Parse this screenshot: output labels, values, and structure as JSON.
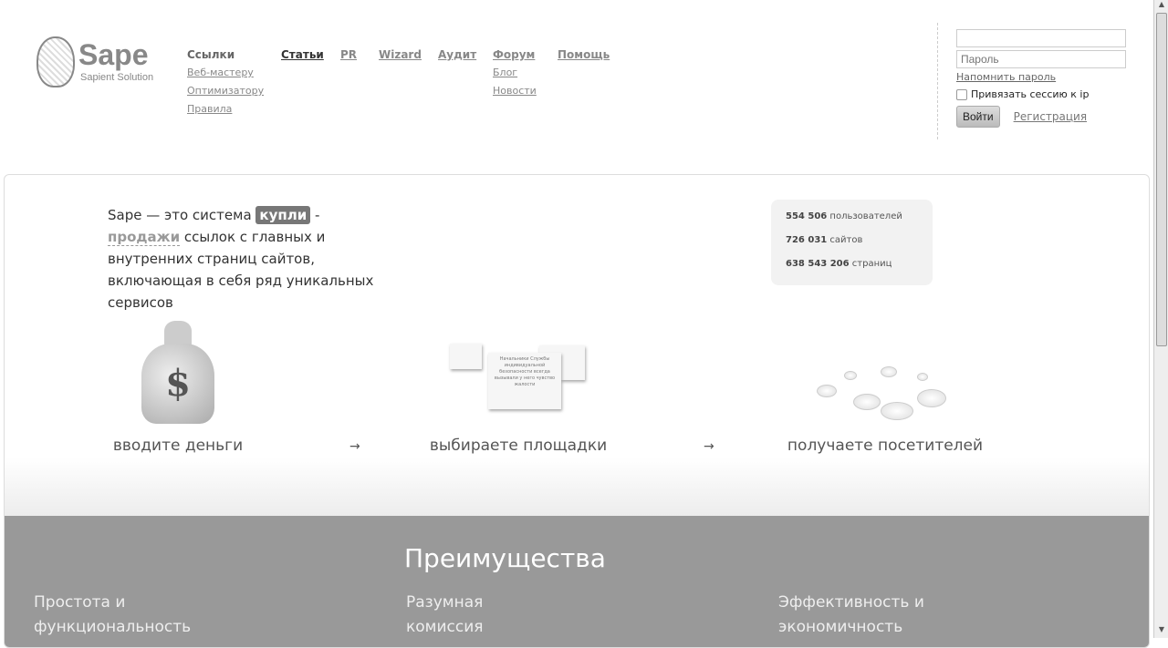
{
  "logo": {
    "name": "Sape",
    "tagline": "Sapient Solution"
  },
  "nav": {
    "links": {
      "title": "Ссылки",
      "items": [
        "Веб-мастеру",
        "Оптимизатору",
        "Правила"
      ]
    },
    "articles": "Статьи",
    "pr": "PR",
    "wizard": "Wizard",
    "audit": "Аудит",
    "forum": {
      "title": "Форум",
      "items": [
        "Блог",
        "Новости"
      ]
    },
    "help": "Помощь"
  },
  "login": {
    "login_value": "",
    "password_placeholder": "Пароль",
    "remind": "Напомнить пароль",
    "bind_session": "Привязать сессию к ip",
    "bind_checked": false,
    "submit": "Войти",
    "register": "Регистрация"
  },
  "intro": {
    "prefix": "Sape — это система",
    "buy": "купли",
    "dash": "-",
    "sell": "продажи",
    "rest": "ссылок с главных и внутренних страниц сайтов, включающая в себя ряд уникальных сервисов"
  },
  "stats": [
    {
      "value": "554 506",
      "label": "пользователей"
    },
    {
      "value": "726 031",
      "label": "сайтов"
    },
    {
      "value": "638 543 206",
      "label": "страниц"
    }
  ],
  "steps": [
    "вводите деньги",
    "выбираете площадки",
    "получаете посетителей"
  ],
  "arrow": "→",
  "bag_symbol": "$",
  "note_text": "Начальники Службы индивидуальной безопасности всегда вызывали у него чувство жалости",
  "advantages": {
    "title": "Преимущества",
    "cols": [
      "Простота и функциональность",
      "Разумная комиссия",
      "Эффективность и экономичность"
    ]
  }
}
